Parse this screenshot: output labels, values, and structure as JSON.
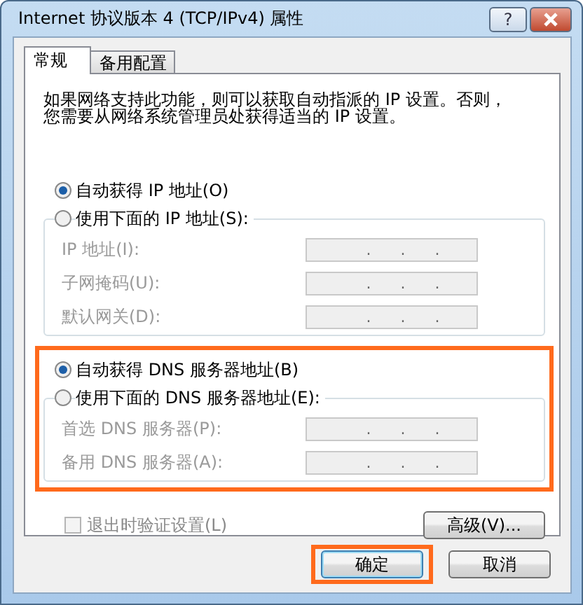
{
  "window": {
    "title": "Internet 协议版本 4 (TCP/IPv4) 属性",
    "help_label": "?"
  },
  "tabs": [
    {
      "label": "常规",
      "selected": true
    },
    {
      "label": "备用配置",
      "selected": false
    }
  ],
  "intro": "如果网络支持此功能，则可以获取自动指派的 IP 设置。否则，您需要从网络系统管理员处获得适当的 IP 设置。",
  "ip_section": {
    "highlighted": false,
    "options": [
      {
        "label": "自动获得 IP 地址(O)",
        "selected": true
      },
      {
        "label": "使用下面的 IP 地址(S):",
        "selected": false
      }
    ],
    "fields": [
      {
        "label": "IP 地址(I):",
        "value": ".      .      .",
        "disabled": true
      },
      {
        "label": "子网掩码(U):",
        "value": ".      .      .",
        "disabled": true
      },
      {
        "label": "默认网关(D):",
        "value": ".      .      .",
        "disabled": true
      }
    ]
  },
  "dns_section": {
    "highlighted": true,
    "options": [
      {
        "label": "自动获得 DNS 服务器地址(B)",
        "selected": true
      },
      {
        "label": "使用下面的 DNS 服务器地址(E):",
        "selected": false
      }
    ],
    "fields": [
      {
        "label": "首选 DNS 服务器(P):",
        "value": ".      .      .",
        "disabled": true
      },
      {
        "label": "备用 DNS 服务器(A):",
        "value": ".      .      .",
        "disabled": true
      }
    ]
  },
  "validate_checkbox": {
    "label": "退出时验证设置(L)",
    "checked": false,
    "disabled": true
  },
  "advanced_button": "高级(V)...",
  "buttons": [
    {
      "label": "确定",
      "default": true,
      "highlighted": true
    },
    {
      "label": "取消",
      "default": false,
      "highlighted": false
    }
  ]
}
